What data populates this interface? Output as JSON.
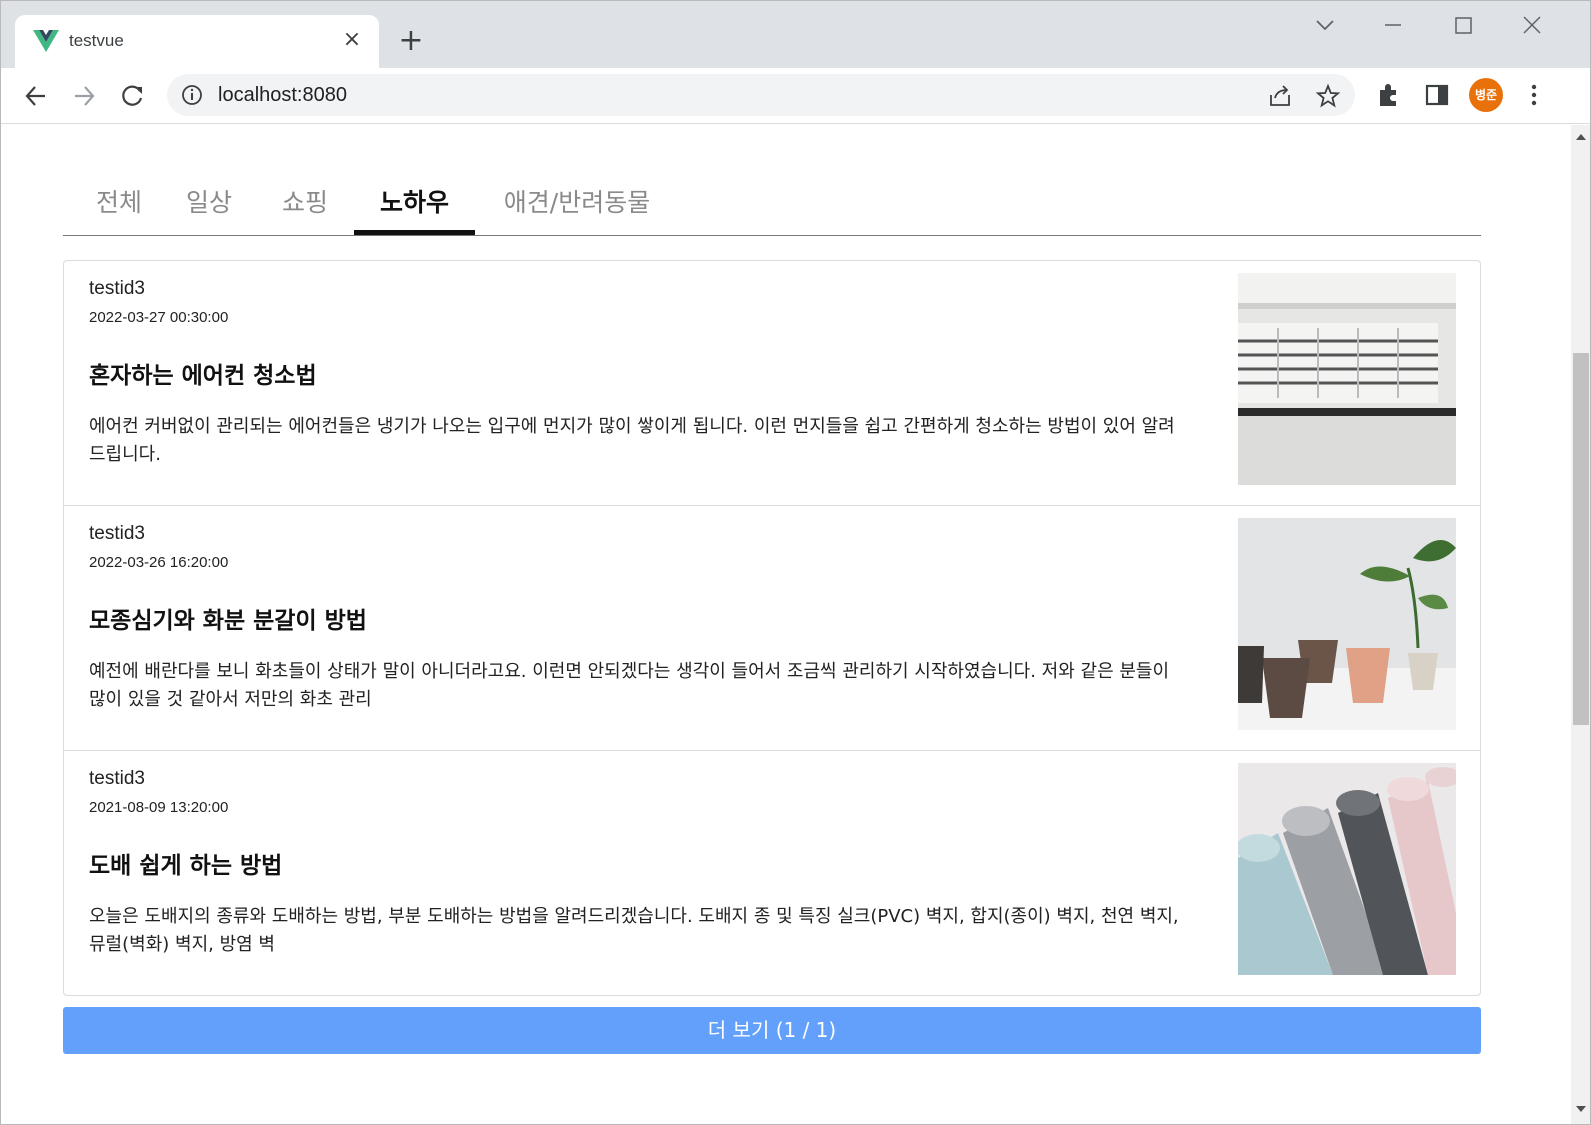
{
  "browser": {
    "tab_title": "testvue",
    "url": "localhost:8080",
    "profile_initials": "병준"
  },
  "categories": [
    "전체",
    "일상",
    "쇼핑",
    "노하우",
    "애견/반려동물"
  ],
  "active_category": "노하우",
  "posts": [
    {
      "author": "testid3",
      "date": "2022-03-27 00:30:00",
      "title": "혼자하는 에어컨 청소법",
      "description": "에어컨 커버없이 관리되는 에어컨들은 냉기가 나오는 입구에 먼지가 많이 쌓이게 됩니다. 이런 먼지들을 쉽고 간편하게 청소하는 방법이 있어 알려드립니다.",
      "image": "air-conditioner-photo"
    },
    {
      "author": "testid3",
      "date": "2022-03-26 16:20:00",
      "title": "모종심기와 화분 분갈이 방법",
      "description": "예전에 배란다를 보니 화초들이 상태가 말이 아니더라고요. 이런면 안되겠다는 생각이 들어서 조금씩 관리하기 시작하였습니다. 저와 같은 분들이 많이 있을 것 같아서 저만의 화초 관리",
      "image": "flower-pots-photo"
    },
    {
      "author": "testid3",
      "date": "2021-08-09 13:20:00",
      "title": "도배 쉽게 하는 방법",
      "description": "오늘은 도배지의 종류와 도배하는 방법, 부분 도배하는 방법을 알려드리겠습니다. 도배지 종 및 특징 실크(PVC) 벽지, 합지(종이) 벽지, 천연 벽지, 뮤럴(벽화) 벽지, 방염 벽",
      "image": "wallpaper-rolls-photo"
    }
  ],
  "more_button": "더 보기 (1 / 1)",
  "colors": {
    "more_button": "#63a0fb",
    "active_tab": "#111111",
    "inactive_tab": "#8a8a8a",
    "avatar": "#e8710a"
  }
}
